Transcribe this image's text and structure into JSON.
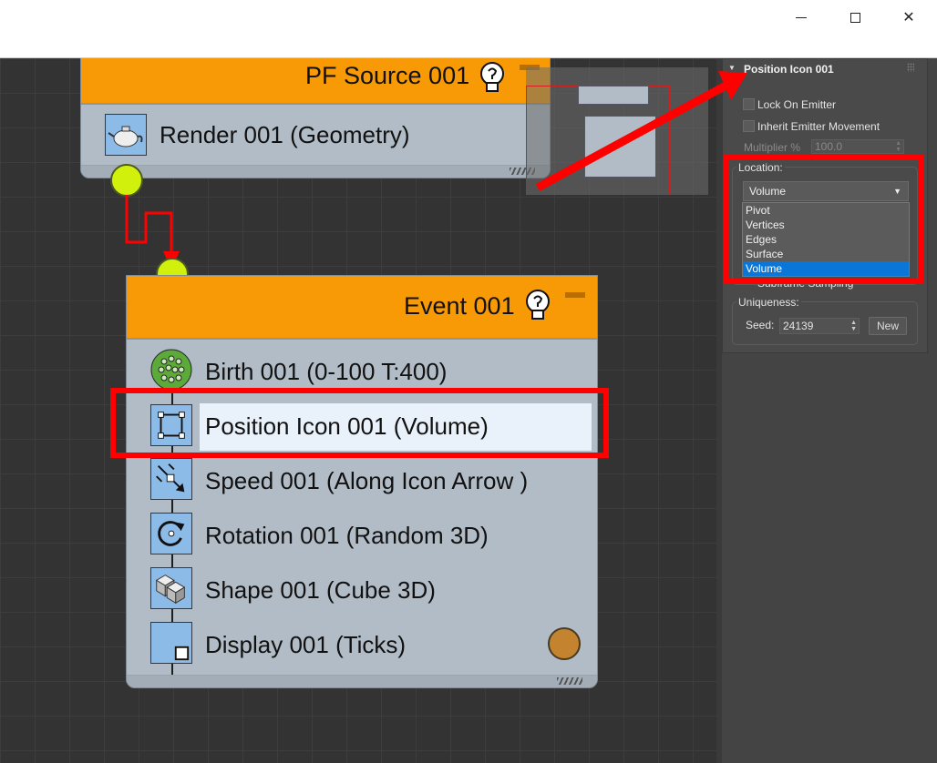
{
  "window": {
    "minimize_label": "",
    "maximize_label": "",
    "close_label": "✕"
  },
  "source_node": {
    "title": "PF Source 001",
    "operators": [
      {
        "icon": "teapot-icon",
        "label": "Render 001 (Geometry)"
      }
    ]
  },
  "event_node": {
    "title": "Event 001",
    "operators": [
      {
        "icon": "birth-icon",
        "label": "Birth 001 (0-100 T:400)"
      },
      {
        "icon": "position-icon",
        "label": "Position Icon 001 (Volume)"
      },
      {
        "icon": "speed-icon",
        "label": "Speed 001 (Along Icon Arrow )"
      },
      {
        "icon": "rotation-icon",
        "label": "Rotation 001 (Random 3D)"
      },
      {
        "icon": "shape-icon",
        "label": "Shape 001 (Cube 3D)"
      },
      {
        "icon": "display-icon",
        "label": "Display 001 (Ticks)"
      }
    ]
  },
  "panel": {
    "rollout_title": "Position Icon 001",
    "lock_on_emitter": "Lock On Emitter",
    "inherit_emitter_movement": "Inherit Emitter Movement",
    "multiplier_label": "Multiplier %",
    "multiplier_value": "100.0",
    "location_label": "Location:",
    "location_selected": "Volume",
    "location_options": [
      "Pivot",
      "Vertices",
      "Edges",
      "Surface",
      "Volume"
    ],
    "hidden_option_fragment": "Subframe Sampling",
    "uniqueness_label": "Uniqueness:",
    "seed_label": "Seed:",
    "seed_value": "24139",
    "new_button": "New"
  },
  "colors": {
    "node_header": "#f79a06",
    "node_body": "#b2bcc6",
    "port": "#d1f10c",
    "annotation": "#ff0000",
    "selected_option": "#0a77d8"
  }
}
